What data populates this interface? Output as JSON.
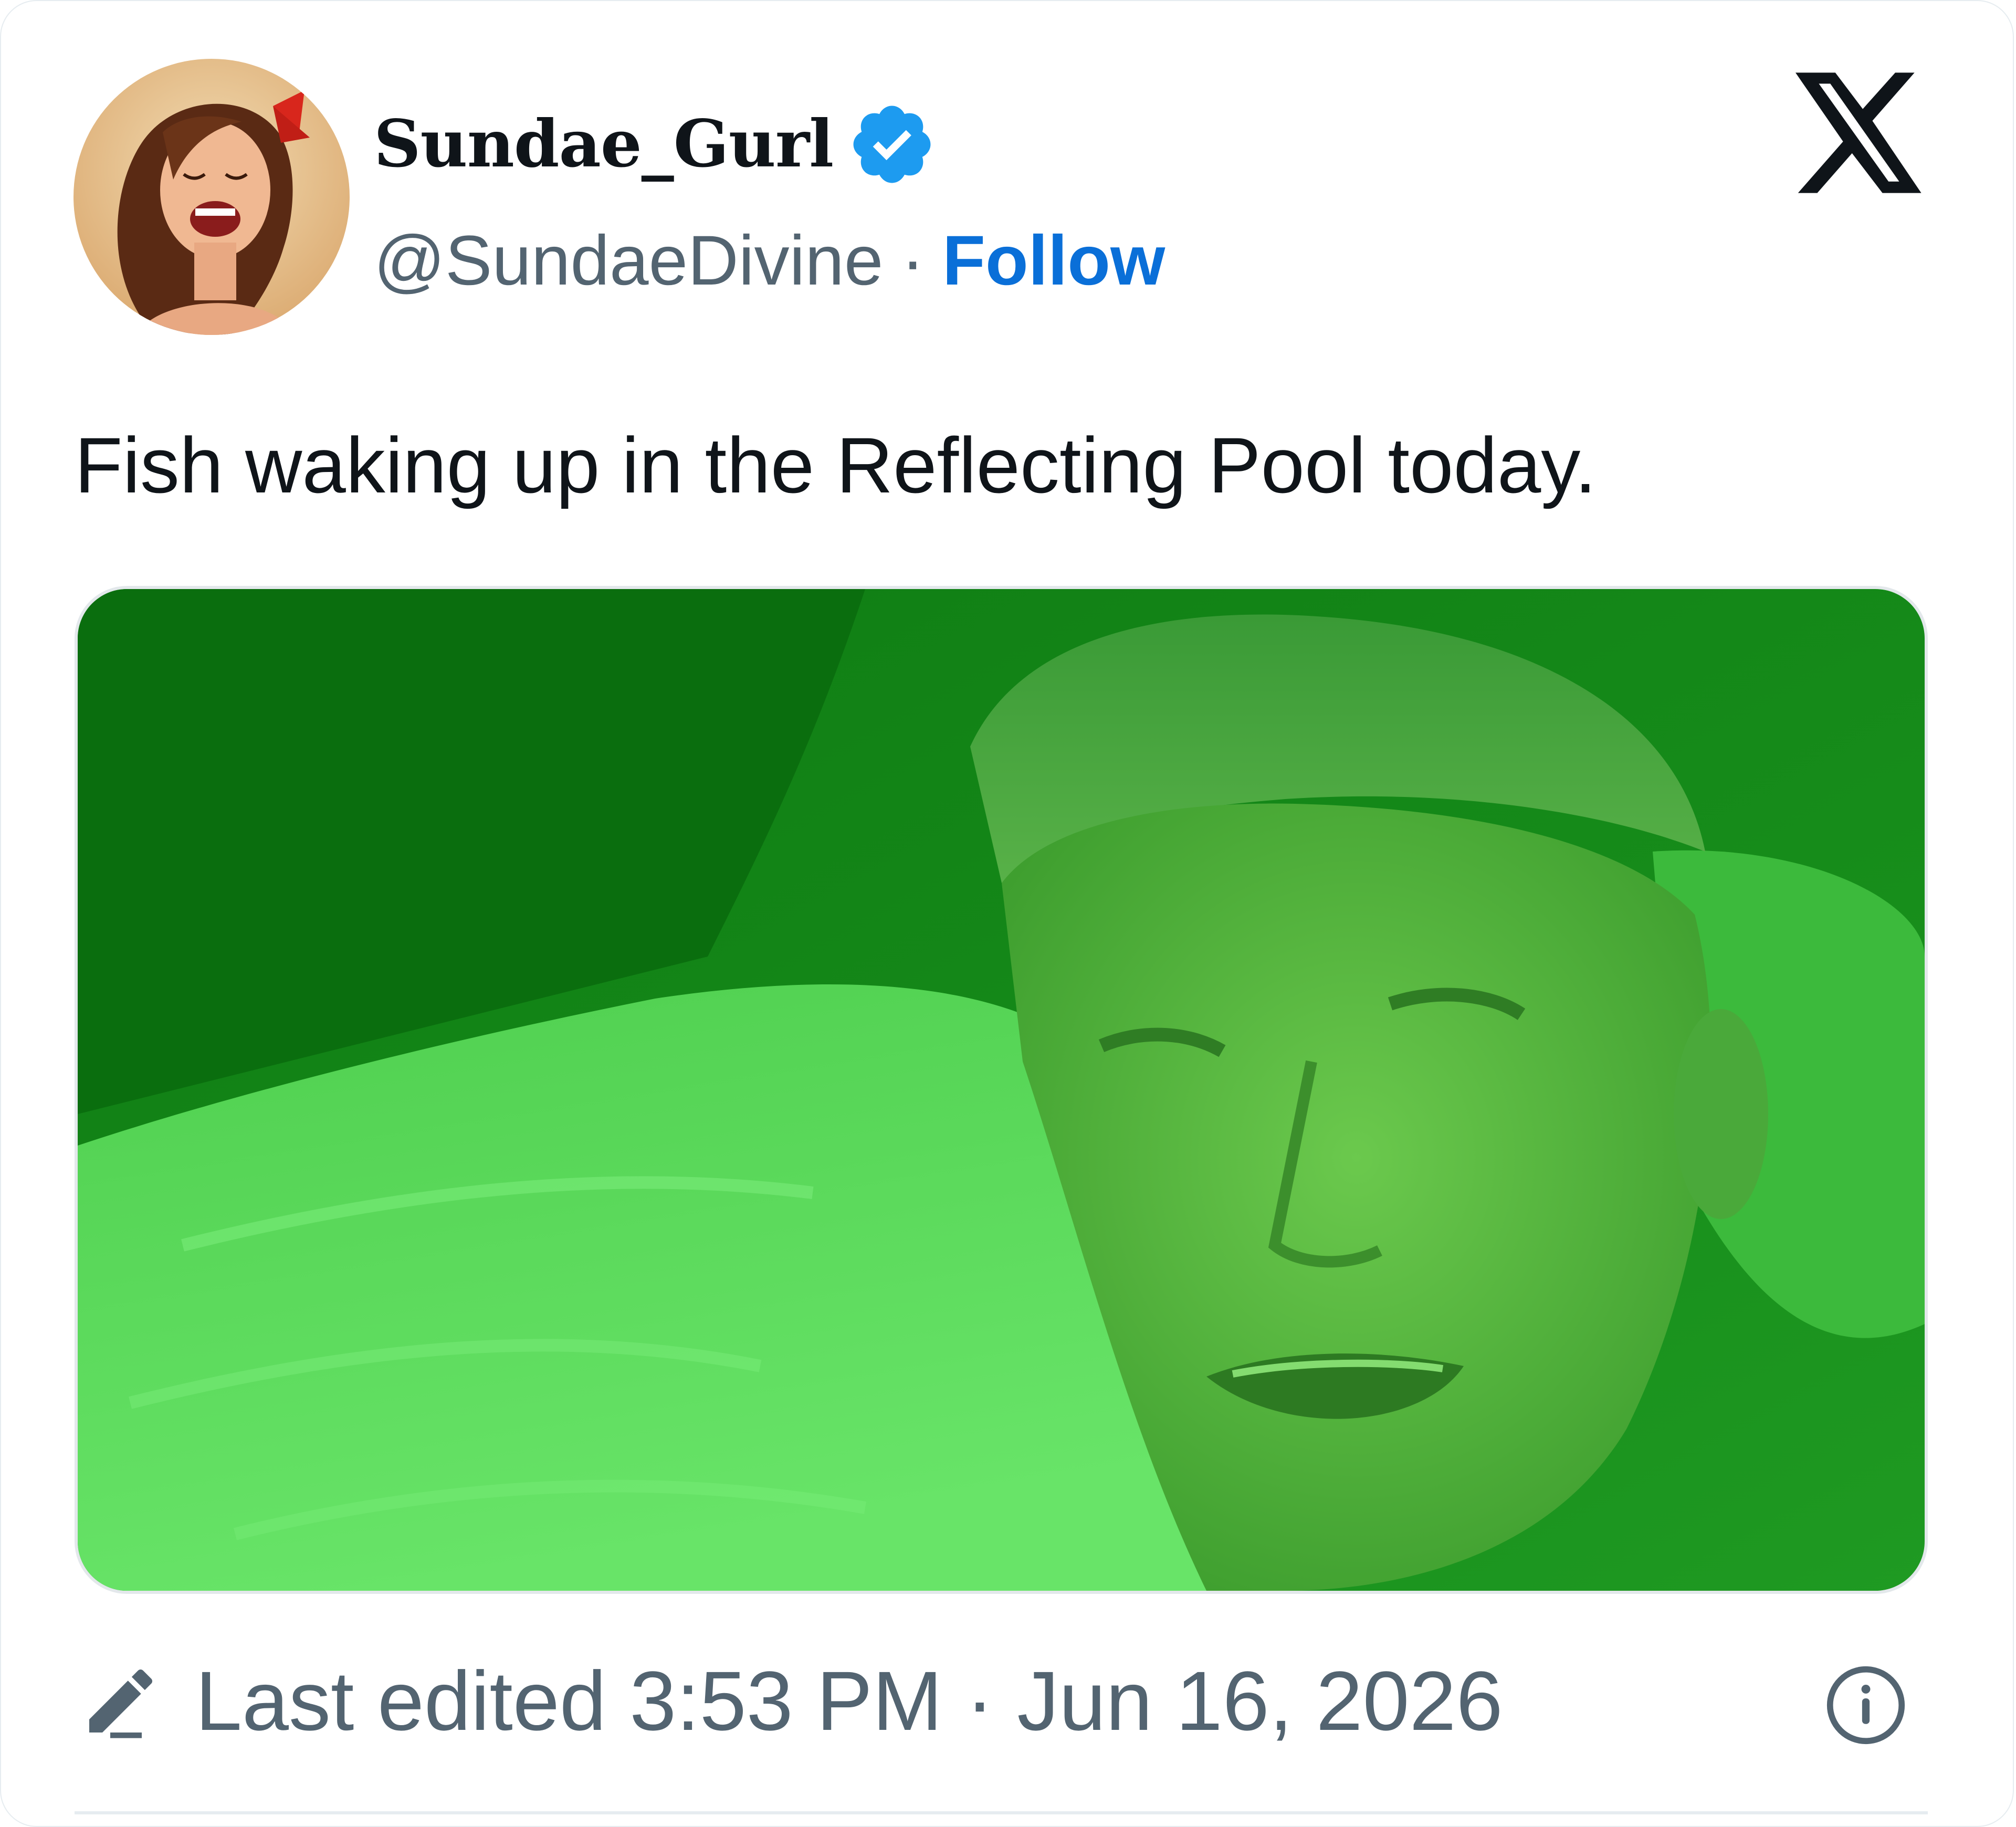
{
  "author": {
    "display_name": "Sundae_Gurl",
    "handle": "@SundaeDivine",
    "separator": "·",
    "follow_label": "Follow",
    "verified": true
  },
  "tweet": {
    "text": "Fish waking up in the Reflecting Pool today.",
    "media_description": "green-tinted image of a man lying on a pillow"
  },
  "footer": {
    "edited_text": "Last edited 3:53 PM · Jun 16, 2026"
  },
  "icons": {
    "platform": "x-logo-icon",
    "verified": "verified-badge-icon",
    "edit": "pencil-icon",
    "info": "info-icon"
  },
  "colors": {
    "follow": "#0a6fd8",
    "verified_badge": "#1d9bf0",
    "secondary_text": "#536471"
  }
}
